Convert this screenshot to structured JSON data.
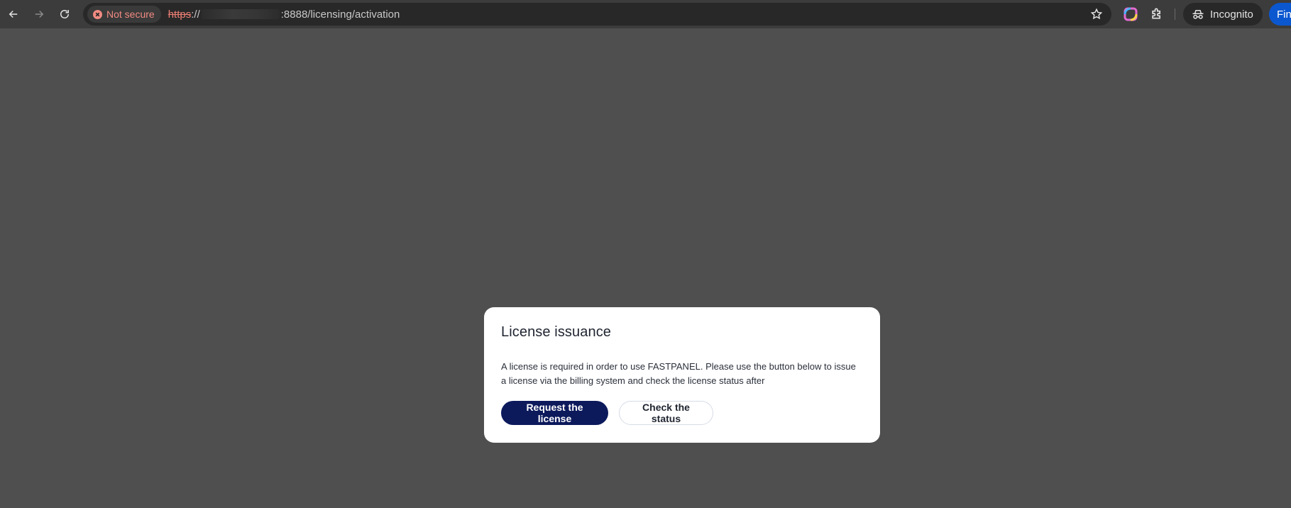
{
  "browser": {
    "security_chip": "Not secure",
    "url": {
      "scheme": "https",
      "separator": "://",
      "rest": ":8888/licensing/activation"
    },
    "incognito_label": "Incognito",
    "finish_label": "Fini"
  },
  "dialog": {
    "title": "License issuance",
    "message": "A license is required in order to use FASTPANEL. Please use the button below to issue a license via the billing system and check the license status after",
    "primary_button": "Request the license",
    "secondary_button": "Check the status"
  },
  "colors": {
    "primary_button": "#0c1a5c",
    "overlay": "#4f4f4f",
    "not_secure": "#f28b82"
  }
}
